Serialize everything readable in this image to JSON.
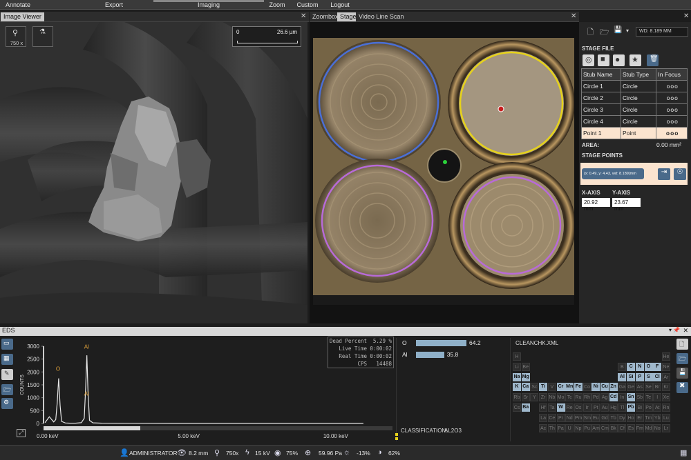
{
  "menu": {
    "items": [
      "Annotate",
      "Export",
      "Imaging",
      "Zoom",
      "Custom",
      "Logout"
    ]
  },
  "image_viewer": {
    "tab": "Image Viewer",
    "magnification": "750 x",
    "scale_start": "0",
    "scale_end": "26.6 µm"
  },
  "stage_tabs": [
    "Zoombox",
    "Stage",
    "Video Line Scan"
  ],
  "right_panel": {
    "wd": "WD: 8.189 MM",
    "stage_file_label": "STAGE FILE",
    "table_headers": [
      "Stub Name",
      "Stub Type",
      "In Focus"
    ],
    "rows": [
      {
        "name": "Circle 1",
        "type": "Circle",
        "focus": "ooo"
      },
      {
        "name": "Circle 2",
        "type": "Circle",
        "focus": "ooo"
      },
      {
        "name": "Circle 3",
        "type": "Circle",
        "focus": "ooo"
      },
      {
        "name": "Circle 4",
        "type": "Circle",
        "focus": "ooo"
      },
      {
        "name": "Point 1",
        "type": "Point",
        "focus": "ooo"
      }
    ],
    "area_label": "AREA:",
    "area_value": "0.00 mm²",
    "stage_points_label": "STAGE POINTS",
    "stage_point": "(x: 0.49, y: 4.43, wd: 8.189)mm",
    "x_axis_label": "X-AXIS",
    "y_axis_label": "Y-AXIS",
    "x_axis_value": "20.92 mm",
    "y_axis_value": "23.67 mm"
  },
  "eds": {
    "title": "EDS",
    "stats": [
      {
        "k": "Dead Percent",
        "v": "5.29 %"
      },
      {
        "k": "Live Time",
        "v": "0:00:02"
      },
      {
        "k": "Real Time",
        "v": "0:00:02"
      },
      {
        "k": "CPS",
        "v": "14488"
      }
    ],
    "elements": [
      {
        "name": "O",
        "value": 64.2,
        "label": "64.2"
      },
      {
        "name": "Al",
        "value": 35.8,
        "label": "35.8"
      }
    ],
    "classification_label": "CLASSIFICATION:",
    "classification_value": "AL2O3",
    "file": "CLEANCHK.XML"
  },
  "chart_data": {
    "type": "line",
    "title": "",
    "xlabel": "",
    "ylabel": "COUNTS",
    "xlim": [
      0,
      12
    ],
    "ylim": [
      0,
      3000
    ],
    "x_ticks": [
      "0.00 keV",
      "5.00 keV",
      "10.00 keV"
    ],
    "y_ticks": [
      "0",
      "500",
      "1000",
      "1500",
      "2000",
      "2500",
      "3000"
    ],
    "peak_labels": [
      {
        "label": "O",
        "x": 0.52,
        "y": 2050
      },
      {
        "label": "Al",
        "x": 1.49,
        "y": 2900
      },
      {
        "label": "Al",
        "x": 1.49,
        "y": 1080
      }
    ],
    "series": [
      {
        "values_x": [
          0.05,
          0.2,
          0.35,
          0.42,
          0.47,
          0.52,
          0.57,
          0.62,
          0.75,
          0.9,
          1.1,
          1.3,
          1.4,
          1.45,
          1.49,
          1.53,
          1.58,
          1.7,
          2.0,
          3.0,
          5.0,
          8.0,
          11.0
        ],
        "values_y": [
          30,
          260,
          60,
          150,
          800,
          1750,
          700,
          80,
          20,
          10,
          10,
          30,
          200,
          1400,
          2650,
          1200,
          120,
          25,
          10,
          5,
          3,
          2,
          2
        ]
      }
    ],
    "color": "#e8e8e8"
  },
  "periodic": [
    {
      "s": "H",
      "r": 0,
      "c": 0,
      "on": false
    },
    {
      "s": "He",
      "r": 0,
      "c": 17,
      "on": false
    },
    {
      "s": "Li",
      "r": 1,
      "c": 0,
      "on": false
    },
    {
      "s": "Be",
      "r": 1,
      "c": 1,
      "on": false
    },
    {
      "s": "B",
      "r": 1,
      "c": 12,
      "on": false
    },
    {
      "s": "C",
      "r": 1,
      "c": 13,
      "on": true
    },
    {
      "s": "N",
      "r": 1,
      "c": 14,
      "on": true
    },
    {
      "s": "O",
      "r": 1,
      "c": 15,
      "on": true
    },
    {
      "s": "F",
      "r": 1,
      "c": 16,
      "on": true
    },
    {
      "s": "Ne",
      "r": 1,
      "c": 17,
      "on": false
    },
    {
      "s": "Na",
      "r": 2,
      "c": 0,
      "on": true
    },
    {
      "s": "Mg",
      "r": 2,
      "c": 1,
      "on": true
    },
    {
      "s": "Al",
      "r": 2,
      "c": 12,
      "on": true
    },
    {
      "s": "Si",
      "r": 2,
      "c": 13,
      "on": true
    },
    {
      "s": "P",
      "r": 2,
      "c": 14,
      "on": true
    },
    {
      "s": "S",
      "r": 2,
      "c": 15,
      "on": true
    },
    {
      "s": "Cl",
      "r": 2,
      "c": 16,
      "on": true
    },
    {
      "s": "Ar",
      "r": 2,
      "c": 17,
      "on": false
    },
    {
      "s": "K",
      "r": 3,
      "c": 0,
      "on": true
    },
    {
      "s": "Ca",
      "r": 3,
      "c": 1,
      "on": true
    },
    {
      "s": "Sc",
      "r": 3,
      "c": 2,
      "on": false
    },
    {
      "s": "Ti",
      "r": 3,
      "c": 3,
      "on": true
    },
    {
      "s": "V",
      "r": 3,
      "c": 4,
      "on": false
    },
    {
      "s": "Cr",
      "r": 3,
      "c": 5,
      "on": true
    },
    {
      "s": "Mn",
      "r": 3,
      "c": 6,
      "on": true
    },
    {
      "s": "Fe",
      "r": 3,
      "c": 7,
      "on": true
    },
    {
      "s": "Co",
      "r": 3,
      "c": 8,
      "on": false
    },
    {
      "s": "Ni",
      "r": 3,
      "c": 9,
      "on": true
    },
    {
      "s": "Cu",
      "r": 3,
      "c": 10,
      "on": true
    },
    {
      "s": "Zn",
      "r": 3,
      "c": 11,
      "on": true
    },
    {
      "s": "Ga",
      "r": 3,
      "c": 12,
      "on": false
    },
    {
      "s": "Ge",
      "r": 3,
      "c": 13,
      "on": false
    },
    {
      "s": "As",
      "r": 3,
      "c": 14,
      "on": false
    },
    {
      "s": "Se",
      "r": 3,
      "c": 15,
      "on": false
    },
    {
      "s": "Br",
      "r": 3,
      "c": 16,
      "on": false
    },
    {
      "s": "Kr",
      "r": 3,
      "c": 17,
      "on": false
    },
    {
      "s": "Rb",
      "r": 4,
      "c": 0,
      "on": false
    },
    {
      "s": "Sr",
      "r": 4,
      "c": 1,
      "on": false
    },
    {
      "s": "Y",
      "r": 4,
      "c": 2,
      "on": false
    },
    {
      "s": "Zr",
      "r": 4,
      "c": 3,
      "on": false
    },
    {
      "s": "Nb",
      "r": 4,
      "c": 4,
      "on": false
    },
    {
      "s": "Mo",
      "r": 4,
      "c": 5,
      "on": false
    },
    {
      "s": "Tc",
      "r": 4,
      "c": 6,
      "on": false
    },
    {
      "s": "Ru",
      "r": 4,
      "c": 7,
      "on": false
    },
    {
      "s": "Rh",
      "r": 4,
      "c": 8,
      "on": false
    },
    {
      "s": "Pd",
      "r": 4,
      "c": 9,
      "on": false
    },
    {
      "s": "Ag",
      "r": 4,
      "c": 10,
      "on": false
    },
    {
      "s": "Cd",
      "r": 4,
      "c": 11,
      "on": true
    },
    {
      "s": "In",
      "r": 4,
      "c": 12,
      "on": false
    },
    {
      "s": "Sn",
      "r": 4,
      "c": 13,
      "on": true
    },
    {
      "s": "Sb",
      "r": 4,
      "c": 14,
      "on": false
    },
    {
      "s": "Te",
      "r": 4,
      "c": 15,
      "on": false
    },
    {
      "s": "I",
      "r": 4,
      "c": 16,
      "on": false
    },
    {
      "s": "Xe",
      "r": 4,
      "c": 17,
      "on": false
    },
    {
      "s": "Cs",
      "r": 5,
      "c": 0,
      "on": false
    },
    {
      "s": "Ba",
      "r": 5,
      "c": 1,
      "on": true
    },
    {
      "s": "Hf",
      "r": 5,
      "c": 3,
      "on": false
    },
    {
      "s": "Ta",
      "r": 5,
      "c": 4,
      "on": false
    },
    {
      "s": "W",
      "r": 5,
      "c": 5,
      "on": true
    },
    {
      "s": "Re",
      "r": 5,
      "c": 6,
      "on": false
    },
    {
      "s": "Os",
      "r": 5,
      "c": 7,
      "on": false
    },
    {
      "s": "Ir",
      "r": 5,
      "c": 8,
      "on": false
    },
    {
      "s": "Pt",
      "r": 5,
      "c": 9,
      "on": false
    },
    {
      "s": "Au",
      "r": 5,
      "c": 10,
      "on": false
    },
    {
      "s": "Hg",
      "r": 5,
      "c": 11,
      "on": false
    },
    {
      "s": "Tl",
      "r": 5,
      "c": 12,
      "on": false
    },
    {
      "s": "Pb",
      "r": 5,
      "c": 13,
      "on": true
    },
    {
      "s": "Bi",
      "r": 5,
      "c": 14,
      "on": false
    },
    {
      "s": "Po",
      "r": 5,
      "c": 15,
      "on": false
    },
    {
      "s": "At",
      "r": 5,
      "c": 16,
      "on": false
    },
    {
      "s": "Rn",
      "r": 5,
      "c": 17,
      "on": false
    },
    {
      "s": "La",
      "r": 6,
      "c": 3,
      "on": false
    },
    {
      "s": "Ce",
      "r": 6,
      "c": 4,
      "on": false
    },
    {
      "s": "Pr",
      "r": 6,
      "c": 5,
      "on": false
    },
    {
      "s": "Nd",
      "r": 6,
      "c": 6,
      "on": false
    },
    {
      "s": "Pm",
      "r": 6,
      "c": 7,
      "on": false
    },
    {
      "s": "Sm",
      "r": 6,
      "c": 8,
      "on": false
    },
    {
      "s": "Eu",
      "r": 6,
      "c": 9,
      "on": false
    },
    {
      "s": "Gd",
      "r": 6,
      "c": 10,
      "on": false
    },
    {
      "s": "Tb",
      "r": 6,
      "c": 11,
      "on": false
    },
    {
      "s": "Dy",
      "r": 6,
      "c": 12,
      "on": false
    },
    {
      "s": "Ho",
      "r": 6,
      "c": 13,
      "on": false
    },
    {
      "s": "Er",
      "r": 6,
      "c": 14,
      "on": false
    },
    {
      "s": "Tm",
      "r": 6,
      "c": 15,
      "on": false
    },
    {
      "s": "Yb",
      "r": 6,
      "c": 16,
      "on": false
    },
    {
      "s": "Lu",
      "r": 6,
      "c": 17,
      "on": false
    },
    {
      "s": "Ac",
      "r": 7,
      "c": 3,
      "on": false
    },
    {
      "s": "Th",
      "r": 7,
      "c": 4,
      "on": false
    },
    {
      "s": "Pa",
      "r": 7,
      "c": 5,
      "on": false
    },
    {
      "s": "U",
      "r": 7,
      "c": 6,
      "on": false
    },
    {
      "s": "Np",
      "r": 7,
      "c": 7,
      "on": false
    },
    {
      "s": "Pu",
      "r": 7,
      "c": 8,
      "on": false
    },
    {
      "s": "Am",
      "r": 7,
      "c": 9,
      "on": false
    },
    {
      "s": "Cm",
      "r": 7,
      "c": 10,
      "on": false
    },
    {
      "s": "Bk",
      "r": 7,
      "c": 11,
      "on": false
    },
    {
      "s": "Cf",
      "r": 7,
      "c": 12,
      "on": false
    },
    {
      "s": "Es",
      "r": 7,
      "c": 13,
      "on": false
    },
    {
      "s": "Fm",
      "r": 7,
      "c": 14,
      "on": false
    },
    {
      "s": "Md",
      "r": 7,
      "c": 15,
      "on": false
    },
    {
      "s": "No",
      "r": 7,
      "c": 16,
      "on": false
    },
    {
      "s": "Lr",
      "r": 7,
      "c": 17,
      "on": false
    }
  ],
  "status_bar": {
    "user": "ADMINISTRATOR",
    "wd": "8.2 mm",
    "mag": "750x",
    "kv": "15 kV",
    "intensity": "75%",
    "pressure": "59.96 Pa",
    "brightness": "-13%",
    "contrast": "62%"
  },
  "colors": {
    "stub_blue": "#4a6fd6",
    "stub_yellow": "#e6d21a",
    "stub_violet": "#b86ad8",
    "selected_row": "#fbe4cf",
    "bar_fill": "#8fb0c8"
  }
}
